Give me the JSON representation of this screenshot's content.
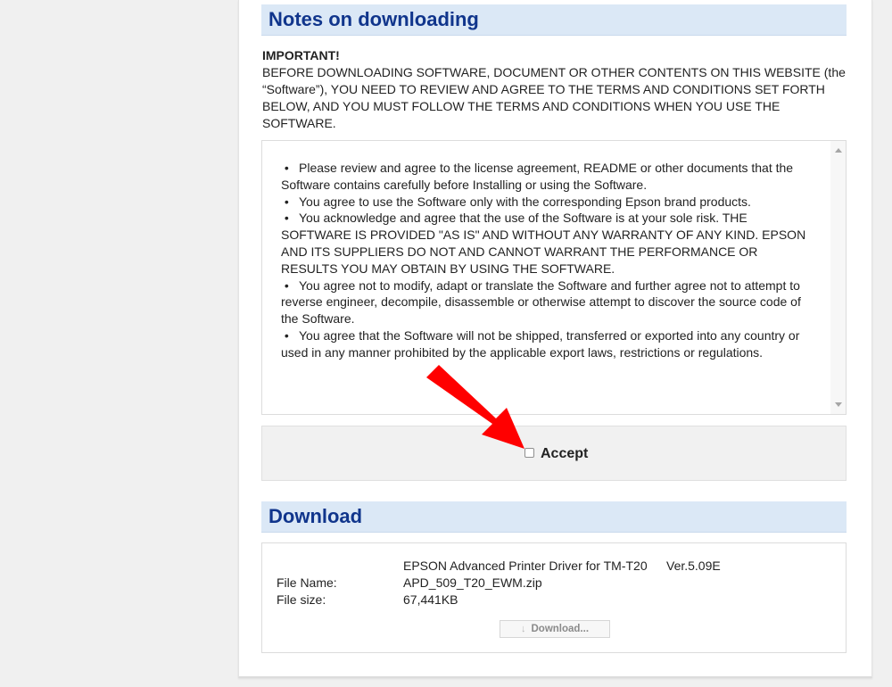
{
  "notes": {
    "heading": "Notes on downloading",
    "important_title": "IMPORTANT!",
    "important_text": "BEFORE DOWNLOADING SOFTWARE, DOCUMENT OR OTHER CONTENTS ON THIS WEBSITE (the “Software”), YOU NEED TO REVIEW AND AGREE TO THE TERMS AND CONDITIONS SET FORTH BELOW, AND YOU MUST FOLLOW THE TERMS AND CONDITIONS WHEN YOU USE THE SOFTWARE.",
    "terms": [
      "Please review and agree to the license agreement, README or other documents that the Software contains carefully before Installing or using the Software.",
      "You agree to use the Software only with the corresponding Epson brand products.",
      "You acknowledge and agree that the use of the Software is at your sole risk. THE SOFTWARE IS PROVIDED \"AS IS\" AND WITHOUT ANY WARRANTY OF ANY KIND. EPSON AND ITS SUPPLIERS DO NOT AND CANNOT WARRANT THE PERFORMANCE OR RESULTS YOU MAY OBTAIN BY USING THE SOFTWARE.",
      "You agree not to modify, adapt or translate the Software and further agree not to attempt to reverse engineer, decompile, disassemble or otherwise attempt to discover the source code of the Software.",
      "You agree that the Software will not be shipped, transferred or exported into any country or used in any manner prohibited by the applicable export laws, restrictions or regulations."
    ],
    "accept_label": "Accept",
    "accept_checked": false
  },
  "download": {
    "heading": "Download",
    "product_name": "EPSON Advanced Printer Driver for TM-T20",
    "version": "Ver.5.09E",
    "file_name_label": "File Name:",
    "file_name": "APD_509_T20_EWM.zip",
    "file_size_label": "File size:",
    "file_size": "67,441KB",
    "button_label": "Download..."
  },
  "colors": {
    "heading_bg": "#dbe8f6",
    "heading_text": "#10358c",
    "arrow": "#ff0000"
  }
}
